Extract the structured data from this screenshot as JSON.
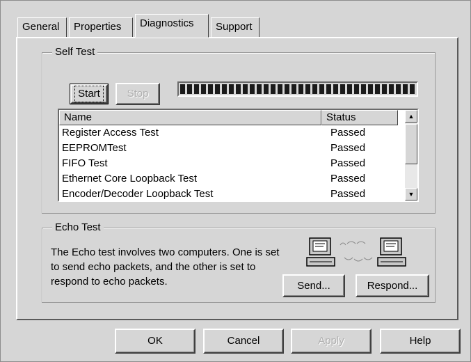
{
  "tabs": [
    {
      "label": "General"
    },
    {
      "label": "Properties"
    },
    {
      "label": "Diagnostics"
    },
    {
      "label": "Support"
    }
  ],
  "self_test": {
    "legend": "Self Test",
    "start_label": "Start",
    "stop_label": "Stop",
    "progress_fraction": 1.0,
    "columns": {
      "name": "Name",
      "status": "Status"
    },
    "rows": [
      {
        "name": "Register Access Test",
        "status": "Passed"
      },
      {
        "name": "EEPROMTest",
        "status": "Passed"
      },
      {
        "name": "FIFO Test",
        "status": "Passed"
      },
      {
        "name": "Ethernet Core Loopback Test",
        "status": "Passed"
      },
      {
        "name": "Encoder/Decoder Loopback Test",
        "status": "Passed"
      }
    ]
  },
  "echo_test": {
    "legend": "Echo Test",
    "description": "The Echo test involves two computers. One is set to send echo packets, and the other is set to respond to echo packets.",
    "send_label": "Send...",
    "respond_label": "Respond..."
  },
  "footer": {
    "ok_label": "OK",
    "cancel_label": "Cancel",
    "apply_label": "Apply",
    "help_label": "Help"
  }
}
